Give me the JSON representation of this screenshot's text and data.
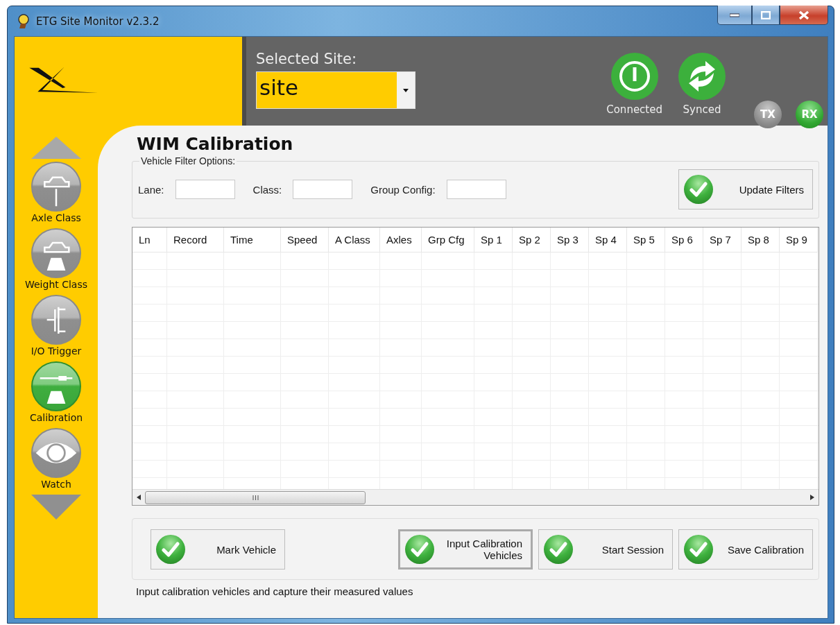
{
  "window": {
    "title": "ETG Site Monitor v2.3.2"
  },
  "site_selector": {
    "label": "Selected Site:",
    "value": "site"
  },
  "status_indicators": [
    {
      "label": "Connected",
      "kind": "power",
      "on": true
    },
    {
      "label": "Synced",
      "kind": "sync",
      "on": true
    }
  ],
  "signal_lights": [
    {
      "label": "TX",
      "on": false
    },
    {
      "label": "RX",
      "on": true
    }
  ],
  "sidebar": {
    "items": [
      {
        "label": "Axle Class",
        "kind": "axle",
        "selected": false
      },
      {
        "label": "Weight Class",
        "kind": "weight",
        "selected": false
      },
      {
        "label": "I/O Trigger",
        "kind": "trigger",
        "selected": false
      },
      {
        "label": "Calibration",
        "kind": "calibration",
        "selected": true
      },
      {
        "label": "Watch",
        "kind": "watch",
        "selected": false
      }
    ]
  },
  "page": {
    "title": "WIM Calibration"
  },
  "filters": {
    "legend": "Vehicle Filter Options:",
    "fields": [
      {
        "label": "Lane:"
      },
      {
        "label": "Class:"
      },
      {
        "label": "Group Config:"
      }
    ],
    "button": "Update Filters"
  },
  "table": {
    "columns": [
      "Ln",
      "Record",
      "Time",
      "Speed",
      "A Class",
      "Axles",
      "Grp Cfg",
      "Sp 1",
      "Sp 2",
      "Sp 3",
      "Sp 4",
      "Sp 5",
      "Sp 6",
      "Sp 7",
      "Sp 8",
      "Sp 9"
    ]
  },
  "actions": [
    {
      "label": "Mark Vehicle",
      "default": false
    },
    {
      "label": "Input Calibration Vehicles",
      "default": true
    },
    {
      "label": "Start Session",
      "default": false
    },
    {
      "label": "Save Calibration",
      "default": false
    }
  ],
  "status_bar": {
    "text": "Input calibration vehicles and capture their measured values"
  }
}
